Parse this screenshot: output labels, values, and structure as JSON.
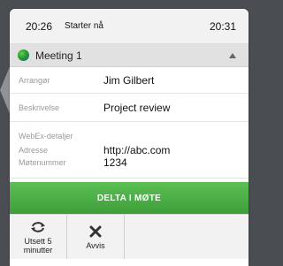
{
  "header": {
    "start_time": "20:26",
    "status": "Starter nå",
    "end_time": "20:31"
  },
  "meeting": {
    "title": "Meeting 1"
  },
  "details": {
    "organizer_label": "Arrangør",
    "organizer_value": "Jim Gilbert",
    "description_label": "Beskrivelse",
    "description_value": "Project review",
    "webex_label": "WebEx-detaljer",
    "address_label": "Adresse",
    "address_value": "http://abc.com",
    "meeting_number_label": "Møtenummer",
    "meeting_number_value": "1234"
  },
  "join_button": {
    "label": "DELTA I MØTE",
    "color": "#4caf45"
  },
  "actions": {
    "snooze_label": "Utsett 5 minutter",
    "dismiss_label": "Avvis"
  },
  "icons": {
    "meeting": "globe-icon",
    "collapse": "chevron-up-icon",
    "snooze": "refresh-icon",
    "dismiss": "close-icon"
  }
}
